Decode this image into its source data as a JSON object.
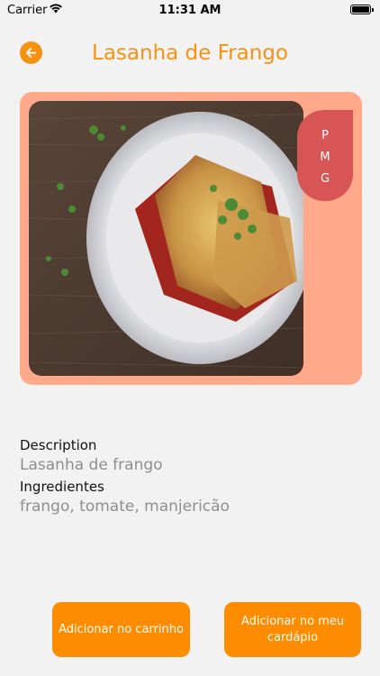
{
  "status_bar": {
    "carrier": "Carrier",
    "time": "11:31 AM"
  },
  "header": {
    "title": "Lasanha de Frango",
    "back_icon": "arrow-left-icon",
    "accent_color": "#f39213"
  },
  "image_card": {
    "background": "#ffa88a",
    "size_selector_color": "#d75655",
    "sizes": [
      "P",
      "M",
      "G"
    ]
  },
  "details": {
    "description_label": "Description",
    "description_value": "Lasanha de frango",
    "ingredients_label": "Ingredientes",
    "ingredients_value": "frango, tomate, manjericão"
  },
  "actions": {
    "add_to_cart_label": "Adicionar no carrinho",
    "add_to_menu_label": "Adicionar no meu cardápio",
    "button_color": "#fe8c01"
  }
}
